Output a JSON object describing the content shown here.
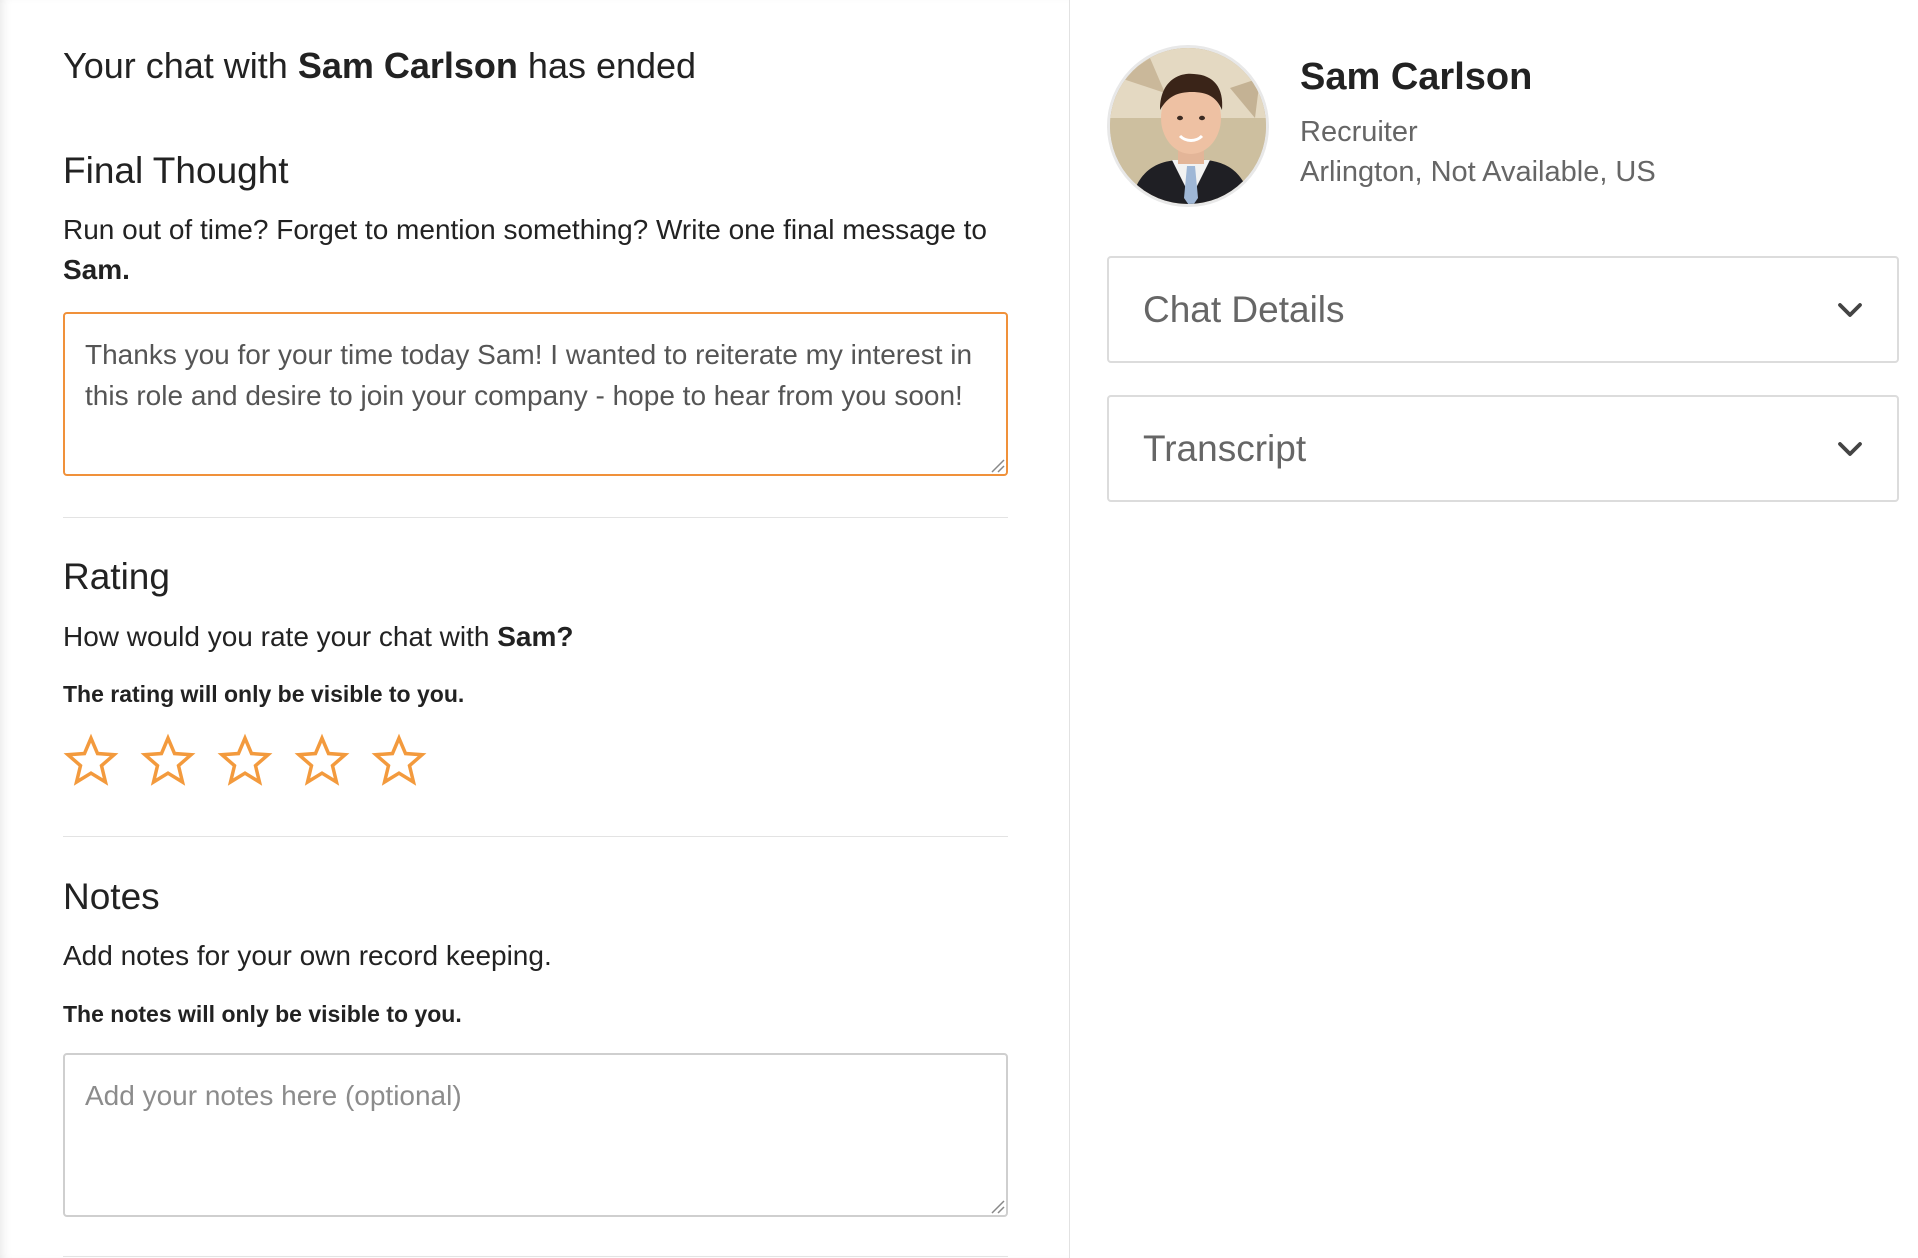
{
  "header": {
    "prefix": "Your chat with",
    "name": "Sam Carlson",
    "suffix": "has ended"
  },
  "final_thought": {
    "title": "Final Thought",
    "description_prefix": "Run out of time? Forget to mention something? Write one final message to",
    "description_name": "Sam.",
    "value": "Thanks you for your time today Sam! I wanted to reiterate my interest in this role and desire to join your company - hope to hear from you soon!"
  },
  "rating": {
    "title": "Rating",
    "question_prefix": "How would you rate your chat with",
    "question_name": "Sam?",
    "note": "The rating will only be visible to you.",
    "max_stars": 5,
    "selected": 0
  },
  "notes": {
    "title": "Notes",
    "description": "Add notes for your own record keeping.",
    "note": "The notes will only be visible to you.",
    "placeholder": "Add your notes here (optional)",
    "value": ""
  },
  "profile": {
    "name": "Sam Carlson",
    "role": "Recruiter",
    "location": "Arlington, Not Available, US"
  },
  "accordions": {
    "chat_details": "Chat Details",
    "transcript": "Transcript"
  },
  "colors": {
    "accent": "#f0913a",
    "star": "#f39a3d",
    "border": "#dcdcdc"
  },
  "icons": {
    "star": "star-outline-icon",
    "chevron": "chevron-down-icon"
  }
}
